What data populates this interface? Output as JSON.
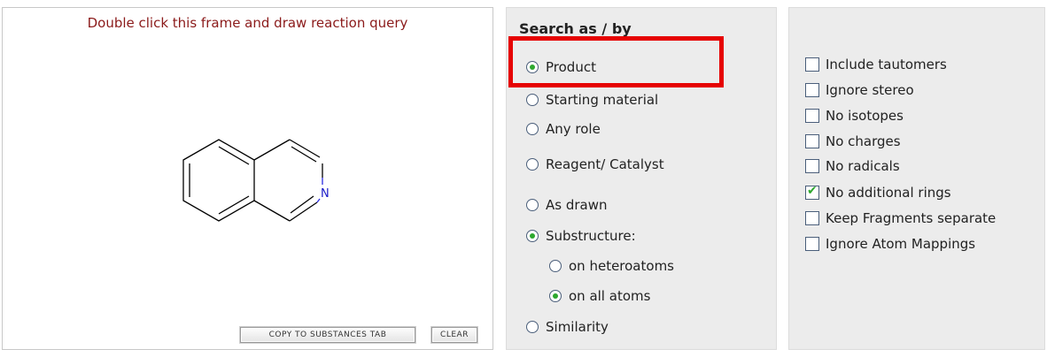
{
  "frame": {
    "hint": "Double click this frame and draw reaction query",
    "atom_label": "N",
    "copy_button": "COPY TO SUBSTANCES TAB",
    "clear_button": "CLEAR"
  },
  "search": {
    "heading": "Search as / by",
    "roles": [
      {
        "label": "Product",
        "checked": true
      },
      {
        "label": "Starting material",
        "checked": false
      },
      {
        "label": "Any role",
        "checked": false
      },
      {
        "label": "Reagent/ Catalyst",
        "checked": false
      }
    ],
    "modes": [
      {
        "label": "As drawn",
        "checked": false
      },
      {
        "label": "Substructure:",
        "checked": true
      },
      {
        "label": "on heteroatoms",
        "checked": false
      },
      {
        "label": "on all atoms",
        "checked": true
      },
      {
        "label": "Similarity",
        "checked": false
      }
    ]
  },
  "options": [
    {
      "label": "Include tautomers",
      "checked": false
    },
    {
      "label": "Ignore stereo",
      "checked": false
    },
    {
      "label": "No isotopes",
      "checked": false
    },
    {
      "label": "No charges",
      "checked": false
    },
    {
      "label": "No radicals",
      "checked": false
    },
    {
      "label": "No additional rings",
      "checked": true
    },
    {
      "label": "Keep Fragments separate",
      "checked": false
    },
    {
      "label": "Ignore Atom Mappings",
      "checked": false
    }
  ],
  "colors": {
    "highlight": "#e60000",
    "hint": "#8b1a1a",
    "check": "#2ea82e"
  }
}
